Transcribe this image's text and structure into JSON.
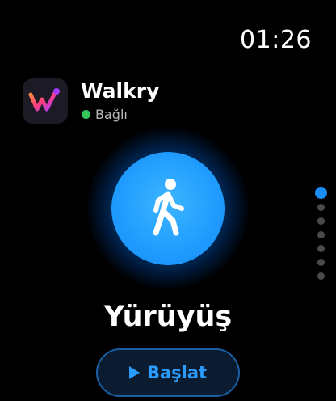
{
  "status_bar": {
    "time": "01:26"
  },
  "app": {
    "name": "Walkry",
    "icon": "walkry-logo-icon",
    "connection_status": "Bağlı",
    "status_color": "#34c759"
  },
  "activity": {
    "icon": "walking-person-icon",
    "title": "Yürüyüş",
    "accent_color": "#1f9bff"
  },
  "pagination": {
    "total": 7,
    "current": 1
  },
  "start_button": {
    "label": "Başlat",
    "icon": "play-icon"
  }
}
